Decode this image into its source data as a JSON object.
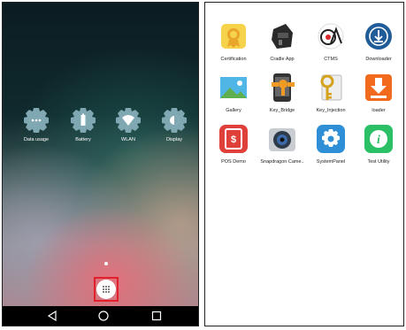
{
  "home": {
    "settings": [
      {
        "label": "Data usage",
        "icon": "dots-icon"
      },
      {
        "label": "Battery",
        "icon": "battery-icon"
      },
      {
        "label": "WLAN",
        "icon": "wifi-icon"
      },
      {
        "label": "Display",
        "icon": "brightness-icon"
      }
    ],
    "navbar": {
      "back": "◁",
      "home": "○",
      "recents": "□"
    }
  },
  "drawer": {
    "apps": [
      {
        "label": "Certification"
      },
      {
        "label": "Cradle App"
      },
      {
        "label": "CTMS"
      },
      {
        "label": "Downloader"
      },
      {
        "label": "Gallery"
      },
      {
        "label": "Key_Bridge"
      },
      {
        "label": "Key_Injection"
      },
      {
        "label": "loader"
      },
      {
        "label": "POS Demo"
      },
      {
        "label": "Snapdragon Came.."
      },
      {
        "label": "SystemPanel"
      },
      {
        "label": "Test Utility"
      }
    ]
  },
  "colors": {
    "accent": "#e0202a",
    "gear": "#7fa8b3",
    "navbar": "#000000"
  }
}
